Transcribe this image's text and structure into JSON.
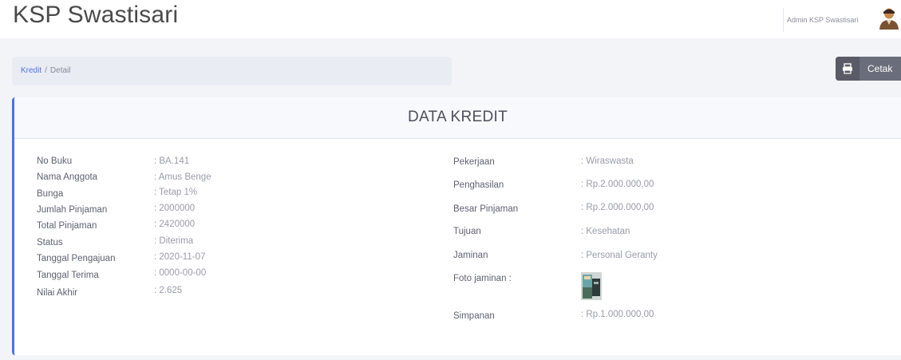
{
  "header": {
    "brand": "KSP Swastisari",
    "user_name": "Admin KSP Swastisari"
  },
  "breadcrumb": {
    "parent": "Kredit",
    "separator": "/",
    "current": "Detail"
  },
  "actions": {
    "print_label": "Cetak"
  },
  "card": {
    "title": "DATA KREDIT",
    "left": [
      {
        "label": "No Buku",
        "value": ": BA.141"
      },
      {
        "label": "Nama Anggota",
        "value": ": Amus Benge"
      },
      {
        "label": "Bunga",
        "value": ": Tetap 1%"
      },
      {
        "label": "Jumlah Pinjaman",
        "value": ": 2000000"
      },
      {
        "label": "Total Pinjaman",
        "value": ": 2420000"
      },
      {
        "label": "Status",
        "value": ": Diterima"
      },
      {
        "label": "Tanggal Pengajuan",
        "value": ": 2020-11-07"
      },
      {
        "label": "Tanggal Terima",
        "value": ": 0000-00-00"
      },
      {
        "label": "Nilai Akhir",
        "value": ": 2.625"
      }
    ],
    "right": [
      {
        "label": "Pekerjaan",
        "value": ": Wiraswasta"
      },
      {
        "label": "Penghasilan",
        "value": ": Rp.2.000.000,00"
      },
      {
        "label": "Besar Pinjaman",
        "value": ": Rp.2.000.000,00"
      },
      {
        "label": "Tujuan",
        "value": ": Kesehatan"
      },
      {
        "label": "Jaminan",
        "value": ": Personal Geranty"
      },
      {
        "label": "Foto jaminan :",
        "value": ""
      },
      {
        "label": "Simpanan",
        "value": ": Rp.1.000.000,00"
      }
    ]
  },
  "icons": {
    "print": "printer-icon",
    "avatar": "user-avatar-icon",
    "collateral_photo": "collateral-photo-thumbnail"
  },
  "colors": {
    "accent": "#4e73df",
    "button": "#6a6d7a",
    "background": "#f3f4f8"
  }
}
